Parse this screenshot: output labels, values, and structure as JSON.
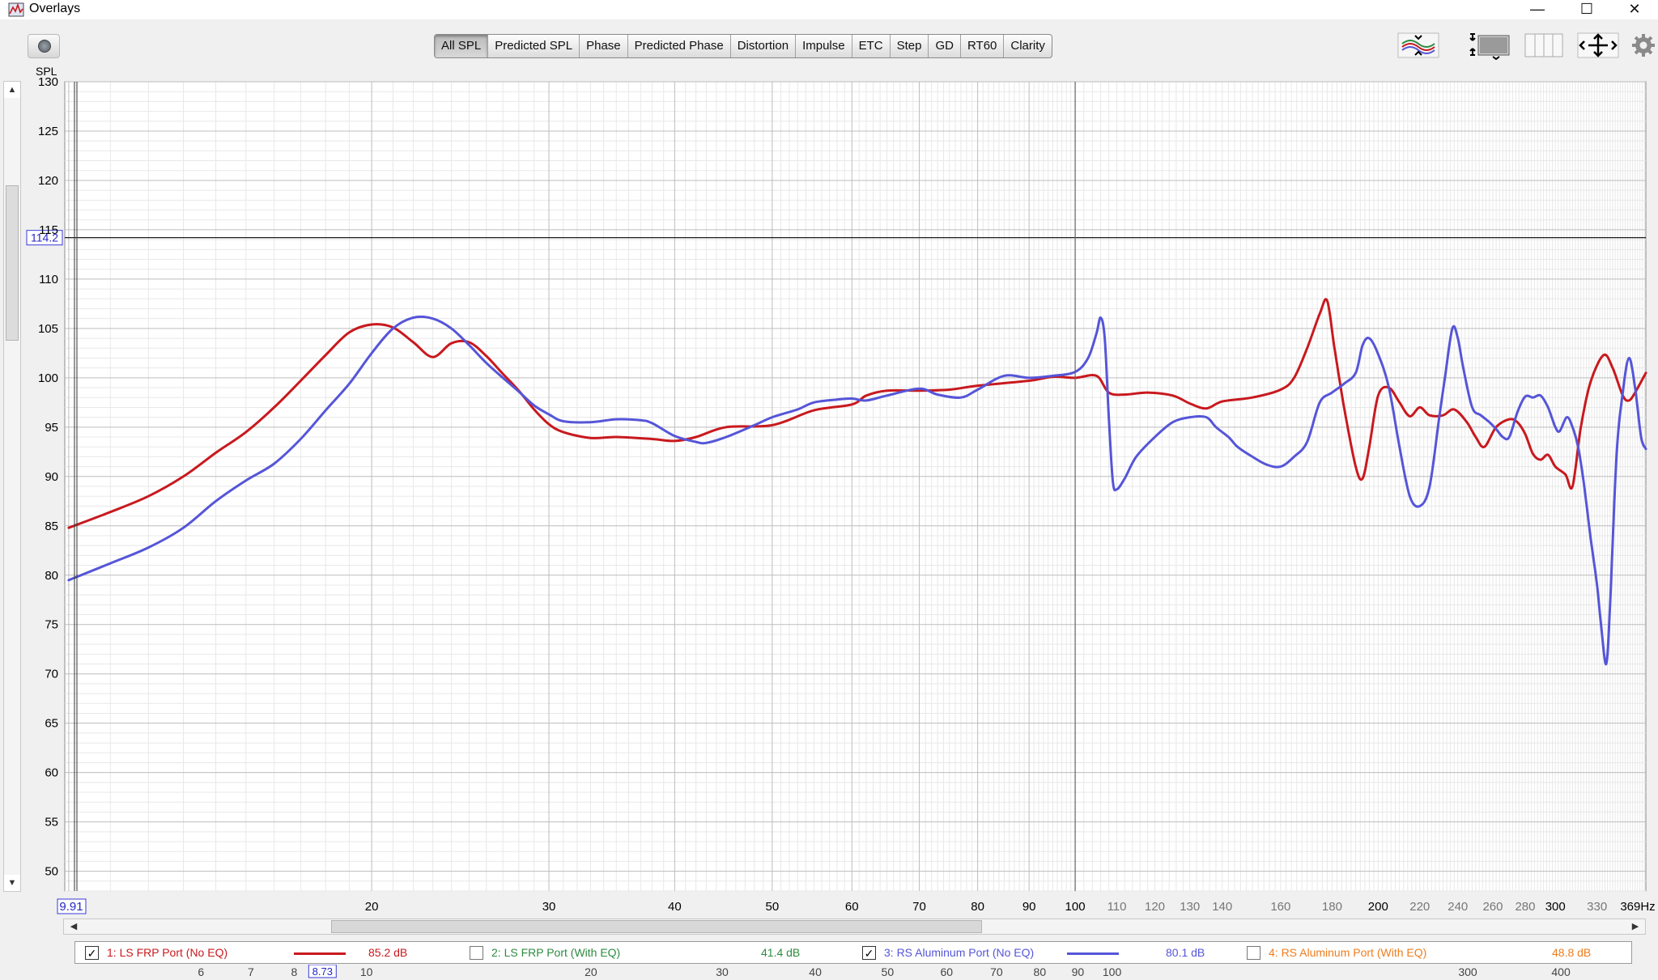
{
  "window": {
    "title": "Overlays",
    "minimize_glyph": "—",
    "maximize_glyph": "☐",
    "close_glyph": "✕"
  },
  "toolbar": {
    "tabs": [
      "All SPL",
      "Predicted SPL",
      "Phase",
      "Predicted Phase",
      "Distortion",
      "Impulse",
      "ETC",
      "Step",
      "GD",
      "RT60",
      "Clarity"
    ],
    "active_tab": "All SPL",
    "icons": [
      "camera-icon",
      "overlay-controls-icon",
      "graph-limits-icon",
      "split-view-icon",
      "pan-zoom-icon",
      "settings-gear-icon"
    ]
  },
  "cursor": {
    "y_readout": "114.2",
    "x_readout": "9.91"
  },
  "bottom_axis": {
    "cursor_label": "8.73",
    "ticks": [
      6,
      7,
      8,
      10,
      20,
      30,
      40,
      50,
      60,
      70,
      80,
      90,
      100,
      300,
      400
    ]
  },
  "legend": {
    "items": [
      {
        "label": "1: LS FRP Port (No EQ)",
        "checked": true,
        "value": "85.2 dB",
        "color": "#c8191e"
      },
      {
        "label": "2: LS FRP Port (With EQ)",
        "checked": false,
        "value": "41.4 dB",
        "color": "#2e8b40"
      },
      {
        "label": "3: RS Aluminum Port (No EQ)",
        "checked": true,
        "value": "80.1 dB",
        "color": "#5555d8"
      },
      {
        "label": "4: RS Aluminum Port (With EQ)",
        "checked": false,
        "value": "48.8 dB",
        "color": "#ee7d1e"
      }
    ]
  },
  "chart_data": {
    "type": "line",
    "title": "",
    "xlabel": "",
    "ylabel": "SPL",
    "x_scale": "log",
    "xlim": [
      9.91,
      369
    ],
    "ylim": [
      48,
      130
    ],
    "x_tick_labels": [
      "9.91",
      "20",
      "30",
      "40",
      "50",
      "60",
      "70",
      "80",
      "90",
      "100",
      "110",
      "120",
      "130",
      "140",
      "160",
      "180",
      "200",
      "220",
      "240",
      "260",
      "280",
      "300",
      "330",
      "369Hz"
    ],
    "y_tick_labels": [
      "50",
      "55",
      "60",
      "65",
      "70",
      "75",
      "80",
      "85",
      "90",
      "95",
      "100",
      "105",
      "110",
      "115",
      "120",
      "125",
      "130"
    ],
    "grid": true,
    "cursor": {
      "x": 100,
      "y": 114.2
    },
    "series": [
      {
        "name": "1: LS FRP Port (No EQ)",
        "color": "#c8191e",
        "points": [
          [
            10,
            84.8
          ],
          [
            11,
            86.4
          ],
          [
            12,
            88
          ],
          [
            13,
            90
          ],
          [
            14,
            92.4
          ],
          [
            15,
            94.5
          ],
          [
            16,
            97
          ],
          [
            17,
            99.7
          ],
          [
            18,
            102.3
          ],
          [
            19,
            104.6
          ],
          [
            20,
            105.4
          ],
          [
            21,
            105.1
          ],
          [
            22,
            103.6
          ],
          [
            23,
            102.1
          ],
          [
            24,
            103.5
          ],
          [
            25,
            103.6
          ],
          [
            26,
            102.2
          ],
          [
            27,
            100.4
          ],
          [
            28,
            98.7
          ],
          [
            29,
            96.8
          ],
          [
            30,
            95.3
          ],
          [
            31,
            94.5
          ],
          [
            33,
            93.9
          ],
          [
            35,
            94
          ],
          [
            38,
            93.8
          ],
          [
            40,
            93.6
          ],
          [
            42,
            94
          ],
          [
            45,
            95
          ],
          [
            50,
            95.2
          ],
          [
            55,
            96.7
          ],
          [
            60,
            97.3
          ],
          [
            62,
            98.2
          ],
          [
            65,
            98.7
          ],
          [
            70,
            98.7
          ],
          [
            75,
            98.8
          ],
          [
            80,
            99.2
          ],
          [
            90,
            99.7
          ],
          [
            95,
            100.1
          ],
          [
            100,
            100
          ],
          [
            105,
            100.2
          ],
          [
            108,
            98.5
          ],
          [
            112,
            98.3
          ],
          [
            118,
            98.5
          ],
          [
            125,
            98.2
          ],
          [
            130,
            97.4
          ],
          [
            135,
            96.9
          ],
          [
            140,
            97.6
          ],
          [
            150,
            98
          ],
          [
            160,
            98.8
          ],
          [
            165,
            100
          ],
          [
            170,
            103
          ],
          [
            175,
            106.5
          ],
          [
            178,
            107.8
          ],
          [
            181,
            103
          ],
          [
            185,
            97
          ],
          [
            190,
            91
          ],
          [
            193,
            89.8
          ],
          [
            196,
            93
          ],
          [
            200,
            98.2
          ],
          [
            205,
            99
          ],
          [
            210,
            97.5
          ],
          [
            215,
            96.1
          ],
          [
            220,
            97
          ],
          [
            225,
            96.2
          ],
          [
            232,
            96.2
          ],
          [
            238,
            96.8
          ],
          [
            245,
            95.5
          ],
          [
            250,
            94
          ],
          [
            255,
            93
          ],
          [
            262,
            95
          ],
          [
            270,
            95.8
          ],
          [
            275,
            95.5
          ],
          [
            280,
            94.3
          ],
          [
            285,
            92.3
          ],
          [
            290,
            91.7
          ],
          [
            295,
            92.2
          ],
          [
            300,
            91
          ],
          [
            307,
            90.2
          ],
          [
            312,
            89
          ],
          [
            318,
            95
          ],
          [
            325,
            99.5
          ],
          [
            335,
            102.3
          ],
          [
            342,
            101
          ],
          [
            350,
            98.2
          ],
          [
            355,
            97.7
          ],
          [
            360,
            98.5
          ],
          [
            369,
            100.5
          ]
        ]
      },
      {
        "name": "3: RS Aluminum Port (No EQ)",
        "color": "#5555d8",
        "points": [
          [
            10,
            79.5
          ],
          [
            11,
            81.2
          ],
          [
            12,
            82.8
          ],
          [
            13,
            84.8
          ],
          [
            14,
            87.5
          ],
          [
            15,
            89.6
          ],
          [
            16,
            91.3
          ],
          [
            17,
            93.8
          ],
          [
            18,
            96.7
          ],
          [
            19,
            99.4
          ],
          [
            20,
            102.5
          ],
          [
            21,
            105
          ],
          [
            22,
            106.1
          ],
          [
            23,
            106
          ],
          [
            24,
            105
          ],
          [
            25,
            103.3
          ],
          [
            26,
            101.5
          ],
          [
            27,
            100
          ],
          [
            28,
            98.6
          ],
          [
            29,
            97.2
          ],
          [
            30,
            96.3
          ],
          [
            31,
            95.6
          ],
          [
            33,
            95.5
          ],
          [
            35,
            95.8
          ],
          [
            37,
            95.7
          ],
          [
            38,
            95.4
          ],
          [
            40,
            94.1
          ],
          [
            42,
            93.5
          ],
          [
            43,
            93.4
          ],
          [
            45,
            94
          ],
          [
            48,
            95.2
          ],
          [
            50,
            96
          ],
          [
            53,
            96.8
          ],
          [
            55,
            97.5
          ],
          [
            58,
            97.8
          ],
          [
            60,
            97.9
          ],
          [
            62,
            97.7
          ],
          [
            65,
            98.2
          ],
          [
            70,
            98.9
          ],
          [
            73,
            98.3
          ],
          [
            77,
            98
          ],
          [
            80,
            98.8
          ],
          [
            85,
            100.2
          ],
          [
            90,
            100
          ],
          [
            95,
            100.2
          ],
          [
            100,
            100.6
          ],
          [
            103,
            102
          ],
          [
            105,
            104.5
          ],
          [
            106,
            106.1
          ],
          [
            107,
            104
          ],
          [
            108,
            96
          ],
          [
            109,
            89.5
          ],
          [
            110,
            88.7
          ],
          [
            112,
            89.8
          ],
          [
            115,
            92
          ],
          [
            120,
            94
          ],
          [
            125,
            95.5
          ],
          [
            130,
            96
          ],
          [
            135,
            96
          ],
          [
            138,
            95
          ],
          [
            142,
            94
          ],
          [
            145,
            93
          ],
          [
            150,
            92
          ],
          [
            155,
            91.2
          ],
          [
            160,
            91
          ],
          [
            165,
            92
          ],
          [
            170,
            93.5
          ],
          [
            175,
            97.5
          ],
          [
            180,
            98.5
          ],
          [
            185,
            99.4
          ],
          [
            190,
            100.5
          ],
          [
            193,
            103.3
          ],
          [
            196,
            104
          ],
          [
            200,
            102.4
          ],
          [
            205,
            99
          ],
          [
            210,
            93
          ],
          [
            215,
            88
          ],
          [
            220,
            87
          ],
          [
            225,
            89
          ],
          [
            230,
            96
          ],
          [
            233,
            100
          ],
          [
            237,
            105
          ],
          [
            240,
            104
          ],
          [
            243,
            101
          ],
          [
            248,
            97
          ],
          [
            253,
            96.2
          ],
          [
            258,
            95.5
          ],
          [
            262,
            94.8
          ],
          [
            266,
            94
          ],
          [
            270,
            94
          ],
          [
            275,
            96.5
          ],
          [
            280,
            98.1
          ],
          [
            285,
            98
          ],
          [
            290,
            98.2
          ],
          [
            295,
            97
          ],
          [
            300,
            95
          ],
          [
            303,
            94.6
          ],
          [
            308,
            96
          ],
          [
            312,
            95
          ],
          [
            316,
            93
          ],
          [
            320,
            89.5
          ],
          [
            325,
            84
          ],
          [
            330,
            79
          ],
          [
            333,
            75
          ],
          [
            337,
            71
          ],
          [
            340,
            77
          ],
          [
            345,
            92
          ],
          [
            350,
            98.5
          ],
          [
            355,
            102
          ],
          [
            360,
            99
          ],
          [
            365,
            94
          ],
          [
            369,
            92.8
          ]
        ]
      }
    ]
  }
}
